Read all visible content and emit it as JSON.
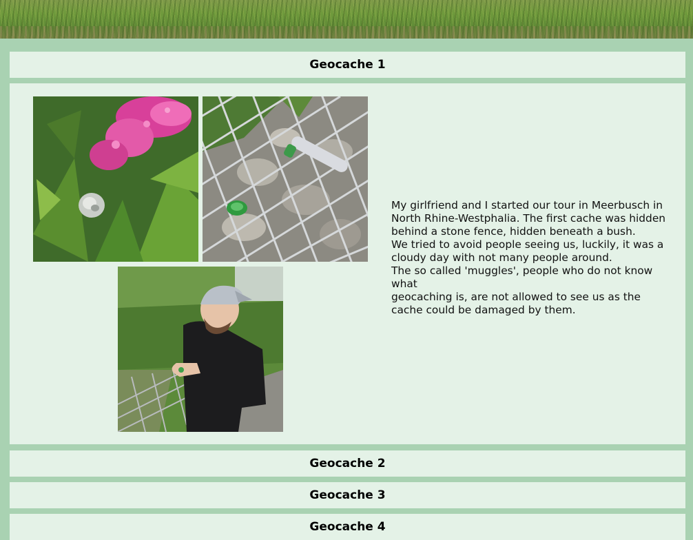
{
  "banner": {
    "image": "grass-meadow-banner"
  },
  "sections": [
    {
      "title": "Geocache 1",
      "expanded": true,
      "photos": [
        {
          "subject": "pink flowers and snail"
        },
        {
          "subject": "tube cache in wire stone fence"
        },
        {
          "subject": "man opening cache"
        }
      ],
      "text": [
        "My girlfriend and I started our tour in Meerbusch in North Rhine-Westphalia. The first cache was hidden behind a stone fence, hidden beneath a bush.",
        "We tried to avoid people seeing us, luckily, it was a cloudy day with not many people around.",
        "The so called 'muggles', people who do not know what",
        "geocaching is, are not allowed to see us as the cache could be damaged by them."
      ]
    },
    {
      "title": "Geocache 2",
      "expanded": false
    },
    {
      "title": "Geocache 3",
      "expanded": false
    },
    {
      "title": "Geocache 4",
      "expanded": false
    }
  ],
  "colors": {
    "page_background": "#a9d2b2",
    "panel_background": "#e4f2e7"
  }
}
